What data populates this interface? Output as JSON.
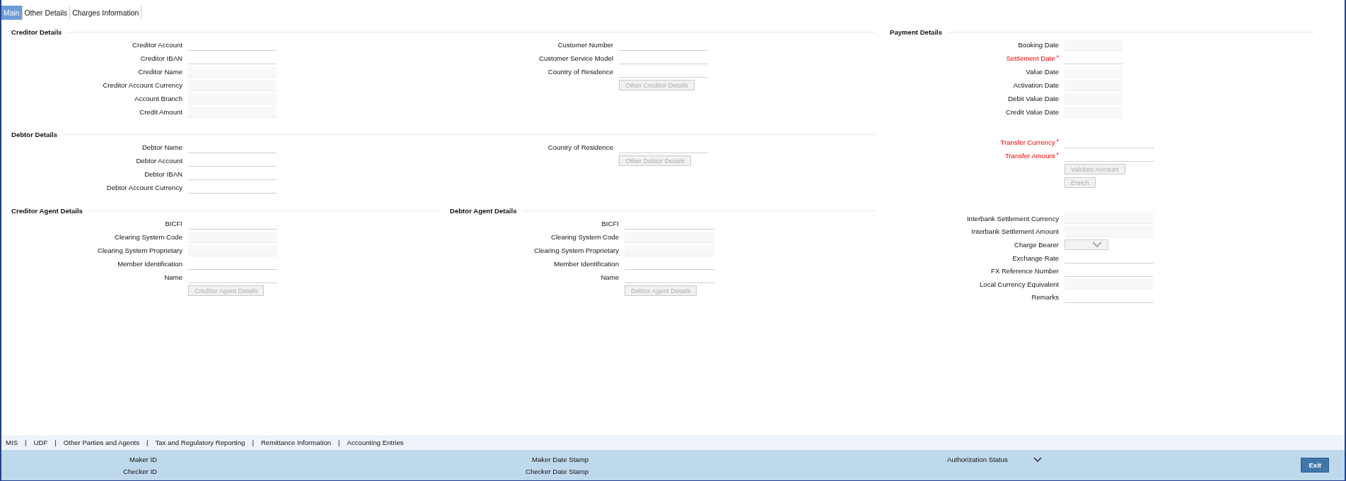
{
  "tabs": [
    {
      "label": "Main",
      "selected": true
    },
    {
      "label": "Other Details",
      "selected": false
    },
    {
      "label": "Charges Information",
      "selected": false
    }
  ],
  "creditor_details": {
    "title": "Creditor Details",
    "columns": [
      {
        "fields": [
          {
            "label": "Creditor Account",
            "kind": "text"
          },
          {
            "label": "Creditor IBAN",
            "kind": "text"
          },
          {
            "label": "Creditor Name",
            "kind": "readonly"
          },
          {
            "label": "Creditor Account Currency",
            "kind": "readonly"
          },
          {
            "label": "Account Branch",
            "kind": "readonly"
          },
          {
            "label": "Credit Amount",
            "kind": "readonly"
          }
        ]
      },
      {
        "fields": [
          {
            "label": "Customer Number",
            "kind": "text"
          },
          {
            "label": "Customer Service Model",
            "kind": "text"
          },
          {
            "label": "Country of Residence",
            "kind": "text"
          }
        ],
        "button": {
          "label": "Other Creditor Details",
          "disabled": true
        }
      }
    ]
  },
  "debtor_details": {
    "title": "Debtor Details",
    "columns": [
      {
        "fields": [
          {
            "label": "Debtor Name",
            "kind": "text"
          },
          {
            "label": "Debtor Account",
            "kind": "text"
          },
          {
            "label": "Debtor IBAN",
            "kind": "text"
          },
          {
            "label": "Debtor Account Currency",
            "kind": "text"
          }
        ]
      },
      {
        "fields": [
          {
            "label": "Country of Residence",
            "kind": "text"
          }
        ],
        "button": {
          "label": "Other Debtor Details",
          "disabled": true
        }
      }
    ]
  },
  "creditor_agent_details": {
    "title": "Creditor Agent Details",
    "columns": [
      {
        "fields": [
          {
            "label": "BICFI",
            "kind": "text"
          },
          {
            "label": "Clearing System Code",
            "kind": "readonly"
          },
          {
            "label": "Clearing System Proprietary",
            "kind": "readonly"
          },
          {
            "label": "Member Identification",
            "kind": "text"
          },
          {
            "label": "Name",
            "kind": "text"
          }
        ],
        "button": {
          "label": "Creditor Agent Details",
          "disabled": true
        }
      }
    ]
  },
  "debtor_agent_details": {
    "title": "Debtor Agent Details",
    "columns": [
      {
        "fields": [
          {
            "label": "BICFI",
            "kind": "text"
          },
          {
            "label": "Clearing System Code",
            "kind": "readonly"
          },
          {
            "label": "Clearing System Proprietary",
            "kind": "readonly"
          },
          {
            "label": "Member Identification",
            "kind": "text"
          },
          {
            "label": "Name",
            "kind": "text"
          }
        ],
        "button": {
          "label": "Debtor Agent Details",
          "disabled": true
        }
      }
    ]
  },
  "payment_details": {
    "title": "Payment Details",
    "groups": [
      {
        "fields": [
          {
            "label": "Booking Date",
            "kind": "readonly"
          },
          {
            "label": "Settlement Date",
            "kind": "text",
            "required_mark": "*"
          },
          {
            "label": "Value Date",
            "kind": "readonly"
          },
          {
            "label": "Activation Date",
            "kind": "readonly"
          },
          {
            "label": "Debit Value Date",
            "kind": "readonly"
          },
          {
            "label": "Credit Value Date",
            "kind": "readonly"
          }
        ]
      },
      {
        "fields": [
          {
            "label": "Transfer Currency",
            "kind": "text",
            "required_mark": "*"
          },
          {
            "label": "Transfer Amount",
            "kind": "text",
            "required_mark": "*"
          }
        ],
        "buttons": [
          {
            "label": "Validate Account",
            "disabled": true
          },
          {
            "label": "Enrich",
            "disabled": true
          }
        ]
      },
      {
        "fields": [
          {
            "label": "Interbank Settlement Currency",
            "kind": "readonly"
          },
          {
            "label": "Interbank Settlement Amount",
            "kind": "readonly"
          },
          {
            "label": "Charge Bearer",
            "kind": "select"
          },
          {
            "label": "Exchange Rate",
            "kind": "text"
          },
          {
            "label": "FX Reference Number",
            "kind": "text"
          },
          {
            "label": "Local Currency Equivalent",
            "kind": "readonly"
          },
          {
            "label": "Remarks",
            "kind": "text"
          }
        ]
      }
    ]
  },
  "bottom_links": {
    "separator": "|",
    "items": [
      "MIS",
      "UDF",
      "Other Parties and Agents",
      "Tax and Regulatory Reporting",
      "Remittance Information",
      "Accounting Entries"
    ]
  },
  "footer": {
    "columns": [
      [
        "Maker ID",
        "Checker ID"
      ],
      [
        "Maker Date Stamp",
        "Checker Date Stamp"
      ]
    ],
    "authorization_status": {
      "label": "Authorization Status"
    },
    "exit_button": {
      "label": "Exit"
    }
  }
}
